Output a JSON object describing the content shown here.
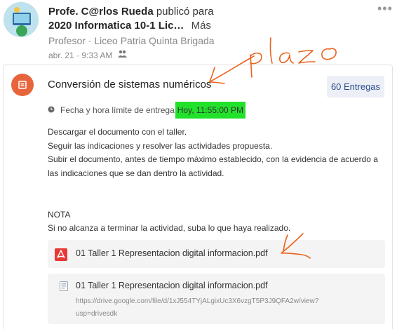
{
  "post": {
    "author": "Profe. C@rlos Rueda",
    "action": "publicó para",
    "group": "2020 Informatica 10-1 Lic…",
    "more_label": "Más",
    "role": "Profesor · Liceo Patria Quinta Brigada",
    "date": "abr. 21 · 9:33 AM"
  },
  "assignment": {
    "title": "Conversión de sistemas numéricos",
    "entregas_label": "60 Entregas",
    "deadline_label": "Fecha y hora límite de entrega",
    "deadline_value": "Hoy, 11:55:00 PM",
    "description": [
      "Descargar el documento con el taller.",
      "Seguir las indicaciones y resolver las actividades propuesta.",
      "Subir el documento, antes de tiempo máximo establecido, con la evidencia de acuerdo a",
      "las indicaciones que se dan dentro la actividad."
    ],
    "nota_title": "NOTA",
    "nota_text": "Si no alcanza a terminar la actividad, suba lo que haya realizado."
  },
  "attachments": [
    {
      "name": "01 Taller 1 Representacion digital informacion.pdf",
      "icon": "pdf-icon"
    },
    {
      "name": "01 Taller 1 Representacion digital informacion.pdf",
      "icon": "document-icon",
      "url_line1": "https://drive.google.com/file/d/1xJ554TYjALgixUc3X6vzgT5P3J9QFA2w/view?",
      "url_line2": "usp=drivesdk"
    }
  ],
  "annotation": {
    "handwritten_text": "plazo",
    "color": "#e8641e"
  },
  "colors": {
    "accent_orange": "#e8643b",
    "highlight_green": "#22e12b",
    "button_text": "#2f4b8f",
    "pdf_red": "#e53935"
  }
}
